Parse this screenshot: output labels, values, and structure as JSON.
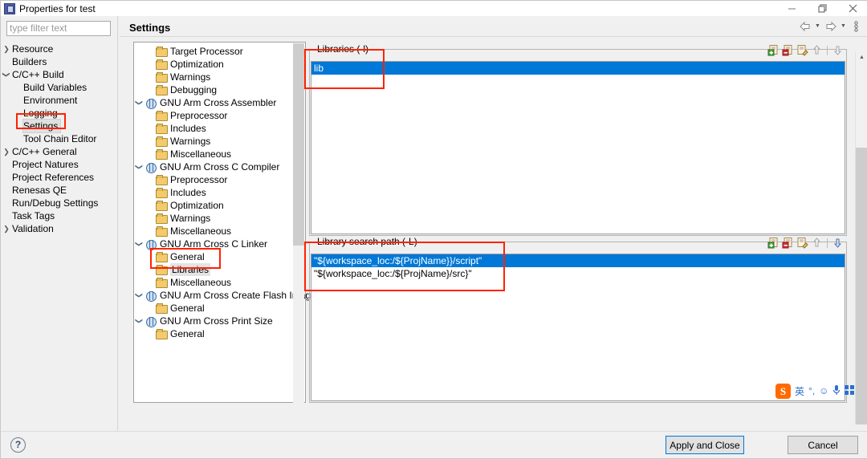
{
  "window": {
    "title": "Properties for test",
    "icon": "properties-window-icon",
    "controls": {
      "minimize": "—",
      "maximize": "❐",
      "close": "✕"
    }
  },
  "filter": {
    "placeholder": "type filter text",
    "value": ""
  },
  "left_tree": [
    {
      "label": "Resource",
      "twisty": "collapsed",
      "indent": 0,
      "selected": false
    },
    {
      "label": "Builders",
      "twisty": "none",
      "indent": 0,
      "selected": false
    },
    {
      "label": "C/C++ Build",
      "twisty": "expanded",
      "indent": 0,
      "selected": false
    },
    {
      "label": "Build Variables",
      "twisty": "none",
      "indent": 1,
      "selected": false
    },
    {
      "label": "Environment",
      "twisty": "none",
      "indent": 1,
      "selected": false
    },
    {
      "label": "Logging",
      "twisty": "none",
      "indent": 1,
      "selected": false
    },
    {
      "label": "Settings",
      "twisty": "none",
      "indent": 1,
      "selected": true
    },
    {
      "label": "Tool Chain Editor",
      "twisty": "none",
      "indent": 1,
      "selected": false
    },
    {
      "label": "C/C++ General",
      "twisty": "collapsed",
      "indent": 0,
      "selected": false
    },
    {
      "label": "Project Natures",
      "twisty": "none",
      "indent": 0,
      "selected": false
    },
    {
      "label": "Project References",
      "twisty": "none",
      "indent": 0,
      "selected": false
    },
    {
      "label": "Renesas QE",
      "twisty": "none",
      "indent": 0,
      "selected": false
    },
    {
      "label": "Run/Debug Settings",
      "twisty": "none",
      "indent": 0,
      "selected": false
    },
    {
      "label": "Task Tags",
      "twisty": "none",
      "indent": 0,
      "selected": false
    },
    {
      "label": "Validation",
      "twisty": "collapsed",
      "indent": 0,
      "selected": false
    }
  ],
  "page": {
    "title": "Settings"
  },
  "nav": {
    "back": "back-arrow",
    "back_menu": "chevron-down-icon",
    "forward": "forward-arrow",
    "forward_menu": "chevron-down-icon",
    "view_menu": "vertical-dots-icon"
  },
  "tool_tree": [
    {
      "label": "Target Processor",
      "icon": "folder-icon",
      "twisty": "none",
      "indent": 1,
      "selected": false
    },
    {
      "label": "Optimization",
      "icon": "folder-icon",
      "twisty": "none",
      "indent": 1,
      "selected": false
    },
    {
      "label": "Warnings",
      "icon": "folder-icon",
      "twisty": "none",
      "indent": 1,
      "selected": false
    },
    {
      "label": "Debugging",
      "icon": "folder-icon",
      "twisty": "none",
      "indent": 1,
      "selected": false
    },
    {
      "label": "GNU Arm Cross Assembler",
      "icon": "tool-icon",
      "twisty": "expanded",
      "indent": 0,
      "selected": false
    },
    {
      "label": "Preprocessor",
      "icon": "folder-icon",
      "twisty": "none",
      "indent": 1,
      "selected": false
    },
    {
      "label": "Includes",
      "icon": "folder-icon",
      "twisty": "none",
      "indent": 1,
      "selected": false
    },
    {
      "label": "Warnings",
      "icon": "folder-icon",
      "twisty": "none",
      "indent": 1,
      "selected": false
    },
    {
      "label": "Miscellaneous",
      "icon": "folder-icon",
      "twisty": "none",
      "indent": 1,
      "selected": false
    },
    {
      "label": "GNU Arm Cross C Compiler",
      "icon": "tool-icon",
      "twisty": "expanded",
      "indent": 0,
      "selected": false
    },
    {
      "label": "Preprocessor",
      "icon": "folder-icon",
      "twisty": "none",
      "indent": 1,
      "selected": false
    },
    {
      "label": "Includes",
      "icon": "folder-icon",
      "twisty": "none",
      "indent": 1,
      "selected": false
    },
    {
      "label": "Optimization",
      "icon": "folder-icon",
      "twisty": "none",
      "indent": 1,
      "selected": false
    },
    {
      "label": "Warnings",
      "icon": "folder-icon",
      "twisty": "none",
      "indent": 1,
      "selected": false
    },
    {
      "label": "Miscellaneous",
      "icon": "folder-icon",
      "twisty": "none",
      "indent": 1,
      "selected": false
    },
    {
      "label": "GNU Arm Cross C Linker",
      "icon": "tool-icon",
      "twisty": "expanded",
      "indent": 0,
      "selected": false
    },
    {
      "label": "General",
      "icon": "folder-icon",
      "twisty": "none",
      "indent": 1,
      "selected": false
    },
    {
      "label": "Libraries",
      "icon": "folder-icon",
      "twisty": "none",
      "indent": 1,
      "selected": true
    },
    {
      "label": "Miscellaneous",
      "icon": "folder-icon",
      "twisty": "none",
      "indent": 1,
      "selected": false
    },
    {
      "label": "GNU Arm Cross Create Flash Image",
      "icon": "tool-icon",
      "twisty": "expanded",
      "indent": 0,
      "selected": false
    },
    {
      "label": "General",
      "icon": "folder-icon",
      "twisty": "none",
      "indent": 1,
      "selected": false
    },
    {
      "label": "GNU Arm Cross Print Size",
      "icon": "tool-icon",
      "twisty": "expanded",
      "indent": 0,
      "selected": false
    },
    {
      "label": "General",
      "icon": "folder-icon",
      "twisty": "none",
      "indent": 1,
      "selected": false
    }
  ],
  "libraries_group": {
    "title": "Libraries (-l)",
    "tools": [
      "add-icon",
      "delete-icon",
      "edit-icon",
      "move-up-icon",
      "move-down-icon"
    ],
    "items": [
      {
        "value": "lib",
        "selected": true
      }
    ]
  },
  "search_path_group": {
    "title": "Library search path (-L)",
    "tools": [
      "add-icon",
      "delete-icon",
      "edit-icon",
      "move-up-icon",
      "move-down-icon"
    ],
    "items": [
      {
        "value": "\"${workspace_loc:/${ProjName}}/script\"",
        "selected": true
      },
      {
        "value": "\"${workspace_loc:/${ProjName}/src}\"",
        "selected": false
      }
    ]
  },
  "footer": {
    "help": "?",
    "apply_label": "Apply and Close",
    "cancel_label": "Cancel"
  },
  "ime": {
    "logo": "S",
    "mode": "英",
    "punctuation": "°,",
    "emoji": "☺",
    "mic": "mic-icon",
    "keyboard": "keyboard-icon"
  },
  "colors": {
    "selection_blue": "#0078d7",
    "annotation_red": "#ff2200",
    "dialog_bg": "#f0f0f0",
    "folder_yellow": "#f3cb6e"
  }
}
